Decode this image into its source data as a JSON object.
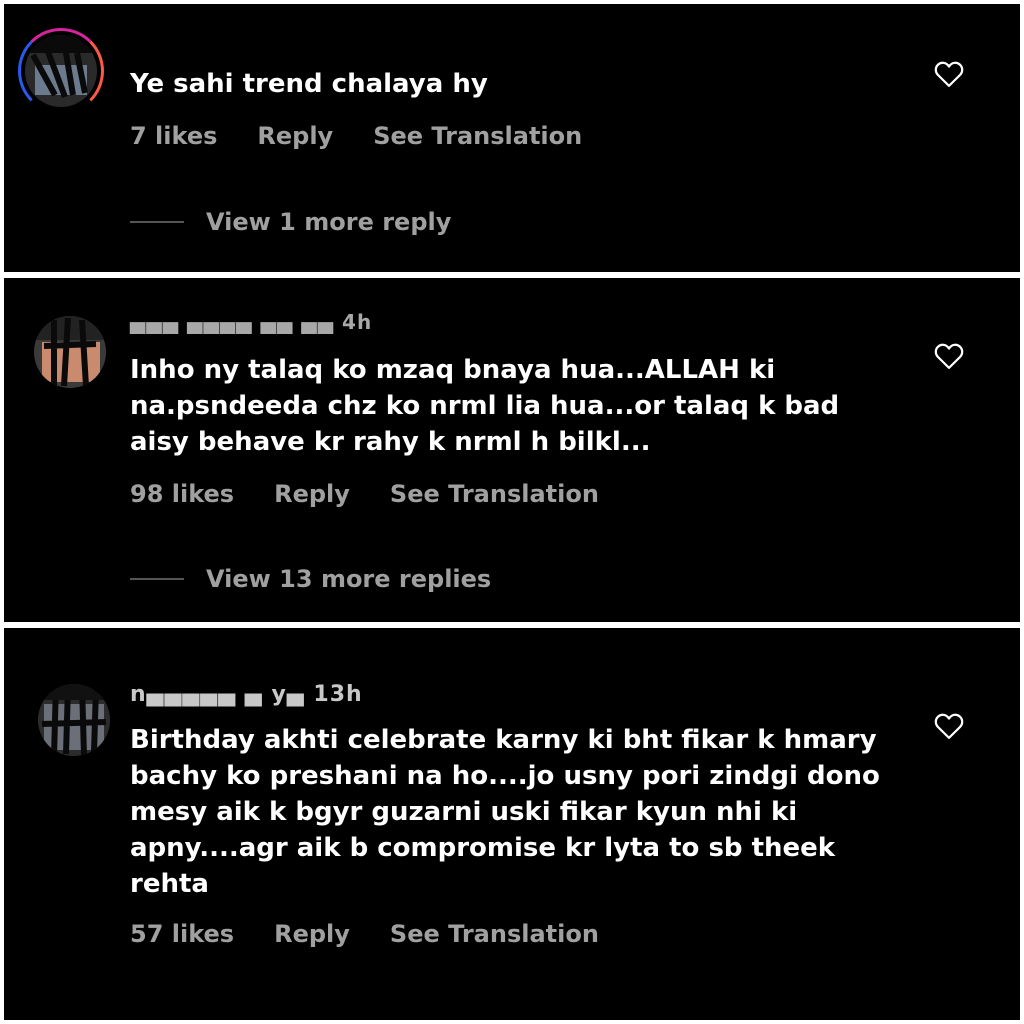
{
  "comments": [
    {
      "handle": "",
      "text": "Ye sahi trend chalaya hy",
      "likes": "7 likes",
      "reply": "Reply",
      "translate": "See Translation",
      "view_more": "View 1 more reply"
    },
    {
      "handle": "▄▄▄ ▄▄▄▄ ▄▄ ▄▄ 4h",
      "text": "Inho ny talaq ko mzaq bnaya hua...ALLAH ki\nna.psndeeda chz ko nrml lia hua...or talaq k bad\naisy behave kr rahy k nrml h bilkl...",
      "likes": "98 likes",
      "reply": "Reply",
      "translate": "See Translation",
      "view_more": "View 13 more replies"
    },
    {
      "handle": "n▄▄▄▄▄ ▄ y▄ 13h",
      "text": "Birthday akhti celebrate karny ki bht fikar k hmary\nbachy ko preshani na ho....jo usny pori zindgi dono\nmesy aik k bgyr guzarni uski fikar kyun nhi ki\napny....agr aik b compromise kr lyta to sb theek\nrehta",
      "likes": "57 likes",
      "reply": "Reply",
      "translate": "See Translation"
    }
  ],
  "colors": {
    "background": "#000000",
    "text": "#ffffff",
    "secondary_text": "#a0a0a0",
    "separator": "#ffffff"
  },
  "icons": {
    "like": "heart-outline-icon"
  }
}
